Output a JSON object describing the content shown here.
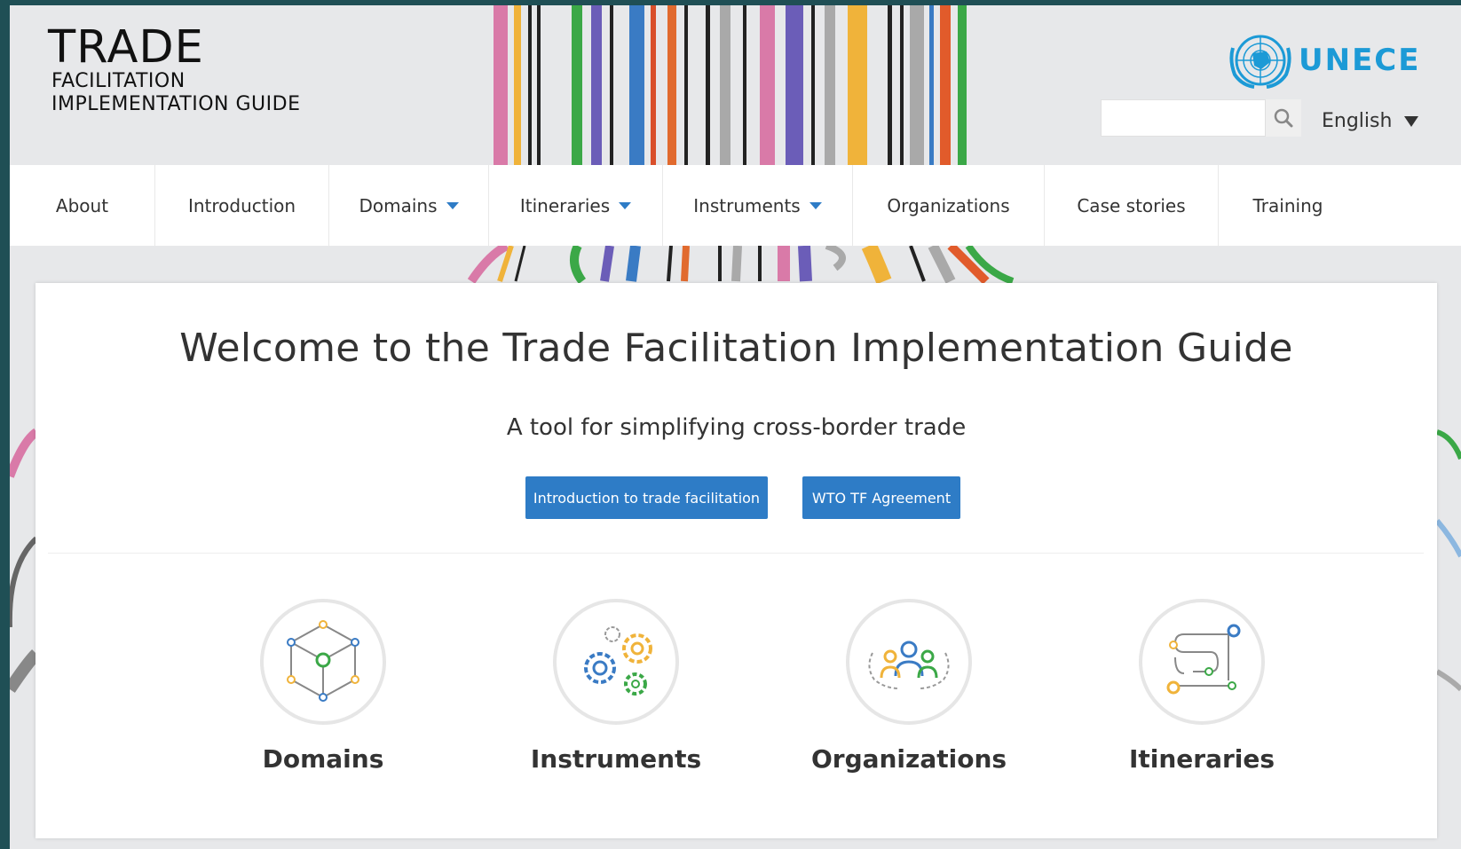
{
  "logo": {
    "line1": "TRADE",
    "line2": "FACILITATION",
    "line3": "IMPLEMENTATION GUIDE"
  },
  "unece": {
    "name": "UNECE",
    "icon": "un-emblem-icon"
  },
  "search": {
    "placeholder": "",
    "value": "",
    "icon": "search-icon"
  },
  "language": {
    "selected": "English"
  },
  "nav": {
    "items": [
      {
        "label": "About",
        "dropdown": false
      },
      {
        "label": "Introduction",
        "dropdown": false
      },
      {
        "label": "Domains",
        "dropdown": true
      },
      {
        "label": "Itineraries",
        "dropdown": true
      },
      {
        "label": "Instruments",
        "dropdown": true
      },
      {
        "label": "Organizations",
        "dropdown": false
      },
      {
        "label": "Case stories",
        "dropdown": false
      },
      {
        "label": "Training",
        "dropdown": false
      }
    ]
  },
  "main": {
    "title": "Welcome to the Trade Facilitation Implementation Guide",
    "tagline": "A tool for simplifying cross-border trade",
    "buttons": {
      "intro": "Introduction to trade facilitation",
      "wto": "WTO TF Agreement"
    },
    "tiles": [
      {
        "label": "Domains",
        "icon": "cube-icon"
      },
      {
        "label": "Instruments",
        "icon": "gears-icon"
      },
      {
        "label": "Organizations",
        "icon": "people-icon"
      },
      {
        "label": "Itineraries",
        "icon": "route-icon"
      }
    ]
  },
  "colors": {
    "accent": "#2e7cc6",
    "unece_blue": "#1c9ad6",
    "frame_bg": "#1f4f55",
    "page_bg": "#e7e8ea"
  }
}
